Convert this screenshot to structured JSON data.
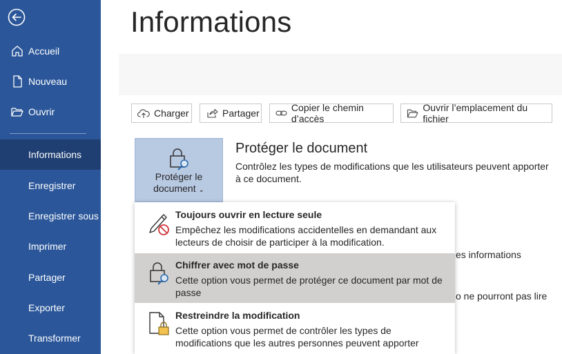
{
  "nav": {
    "back_icon": "back-arrow-icon",
    "items": [
      {
        "label": "Accueil",
        "icon": "home-icon"
      },
      {
        "label": "Nouveau",
        "icon": "new-document-icon"
      },
      {
        "label": "Ouvrir",
        "icon": "folder-open-icon"
      },
      {
        "label": "Informations"
      },
      {
        "label": "Enregistrer"
      },
      {
        "label": "Enregistrer sous"
      },
      {
        "label": "Imprimer"
      },
      {
        "label": "Partager"
      },
      {
        "label": "Exporter"
      },
      {
        "label": "Transformer"
      }
    ],
    "selected": "Informations"
  },
  "page": {
    "title": "Informations"
  },
  "toolbar": {
    "buttons": [
      {
        "label": "Charger",
        "icon": "cloud-upload-icon"
      },
      {
        "label": "Partager",
        "icon": "share-icon"
      },
      {
        "label": "Copier le chemin d’accès",
        "icon": "link-icon"
      },
      {
        "label": "Ouvrir l’emplacement du fichier",
        "icon": "folder-open-icon"
      }
    ]
  },
  "protect": {
    "tile_label_line1": "Protéger le",
    "tile_label_line2": "document",
    "tile_icon": "lock-key-icon",
    "title": "Protéger le document",
    "description": "Contrôlez les types de modifications que les utilisateurs peuvent apporter à ce document."
  },
  "background_text": {
    "line1": "es informations",
    "line2": "o ne pourront pas lire"
  },
  "dropdown": {
    "items": [
      {
        "title": "Toujours ouvrir en lecture seule",
        "description": "Empêchez les modifications accidentelles en demandant aux lecteurs de choisir de participer à la modification.",
        "icon": "pencil-no-icon"
      },
      {
        "title": "Chiffrer avec mot de passe",
        "description": "Cette option vous permet de protéger ce document par mot de passe",
        "icon": "lock-key-icon"
      },
      {
        "title": "Restreindre la modification",
        "description": "Cette option vous permet de contrôler les types de modifications que les autres personnes peuvent apporter",
        "icon": "document-lock-icon"
      }
    ]
  },
  "colors": {
    "sidebar": "#2b579a",
    "sidebar_selected": "#1f3f73",
    "tile": "#b8c9e2",
    "hover": "#d2d0ce"
  }
}
